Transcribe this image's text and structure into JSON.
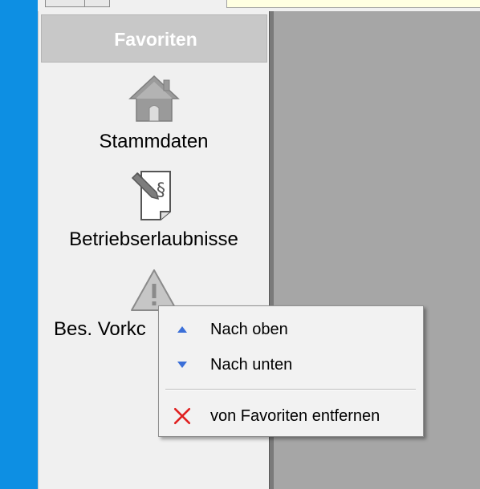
{
  "favorites": {
    "header_title": "Favoriten",
    "items": [
      {
        "label": "Stammdaten",
        "icon": "house-icon"
      },
      {
        "label": "Betriebserlaubnisse",
        "icon": "document-pen-icon"
      },
      {
        "label": "Bes. Vorkc",
        "icon": "warning-icon"
      }
    ]
  },
  "context_menu": {
    "items": [
      {
        "label": "Nach oben",
        "icon": "triangle-up-icon"
      },
      {
        "label": "Nach unten",
        "icon": "triangle-down-icon"
      },
      {
        "label": "von Favoriten entfernen",
        "icon": "red-x-icon"
      }
    ]
  },
  "colors": {
    "desktop_blue": "#0d8fe3",
    "panel_bg": "#f0f0f0",
    "header_bg": "#c8c8c8",
    "content_bg": "#a6a6a6",
    "menu_bg": "#f2f2f2",
    "arrow_blue": "#3b6fd8",
    "remove_red": "#e02020"
  }
}
